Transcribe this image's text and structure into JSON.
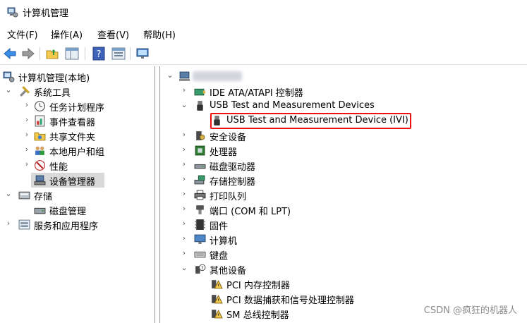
{
  "window": {
    "title": "计算机管理"
  },
  "menu": [
    "文件(F)",
    "操作(A)",
    "查看(V)",
    "帮助(H)"
  ],
  "toolbar": {
    "icons": [
      "back-icon",
      "forward-icon",
      "up-folder-icon",
      "show-hide-tree-icon",
      "help-icon",
      "properties-icon",
      "monitor-icon"
    ]
  },
  "left_tree": [
    {
      "label": "计算机管理(本地)",
      "icon": "computer-management-icon"
    },
    {
      "label": "系统工具",
      "icon": "tools-icon"
    },
    {
      "label": "任务计划程序",
      "icon": "clock-icon"
    },
    {
      "label": "事件查看器",
      "icon": "event-viewer-icon"
    },
    {
      "label": "共享文件夹",
      "icon": "shared-folder-icon"
    },
    {
      "label": "本地用户和组",
      "icon": "users-icon"
    },
    {
      "label": "性能",
      "icon": "performance-icon"
    },
    {
      "label": "设备管理器",
      "icon": "device-manager-icon"
    },
    {
      "label": "存储",
      "icon": "storage-icon"
    },
    {
      "label": "磁盘管理",
      "icon": "disk-icon"
    },
    {
      "label": "服务和应用程序",
      "icon": "services-icon"
    }
  ],
  "right_tree": [
    {
      "label": "",
      "icon": "computer-icon"
    },
    {
      "label": "IDE ATA/ATAPI 控制器",
      "icon": "ide-controller-icon"
    },
    {
      "label": "USB Test and Measurement Devices",
      "icon": "usb-icon"
    },
    {
      "label": "USB Test and Measurement Device (IVI)",
      "icon": "usb-device-icon"
    },
    {
      "label": "安全设备",
      "icon": "security-device-icon"
    },
    {
      "label": "处理器",
      "icon": "processor-icon"
    },
    {
      "label": "磁盘驱动器",
      "icon": "disk-drive-icon"
    },
    {
      "label": "存储控制器",
      "icon": "storage-controller-icon"
    },
    {
      "label": "打印队列",
      "icon": "printer-icon"
    },
    {
      "label": "端口 (COM 和 LPT)",
      "icon": "port-icon"
    },
    {
      "label": "固件",
      "icon": "firmware-icon"
    },
    {
      "label": "计算机",
      "icon": "monitor-icon"
    },
    {
      "label": "键盘",
      "icon": "keyboard-icon"
    },
    {
      "label": "其他设备",
      "icon": "other-devices-icon"
    },
    {
      "label": "PCI 内存控制器",
      "icon": "warning-device-icon"
    },
    {
      "label": "PCI 数据捕获和信号处理控制器",
      "icon": "warning-device-icon"
    },
    {
      "label": "SM 总线控制器",
      "icon": "warning-device-icon"
    }
  ],
  "watermark": "CSDN @疯狂的机器人",
  "colors": {
    "highlight_border": "#ee1111",
    "selected_bg": "#d9d9d9",
    "back_arrow": "#3a8ee6"
  }
}
